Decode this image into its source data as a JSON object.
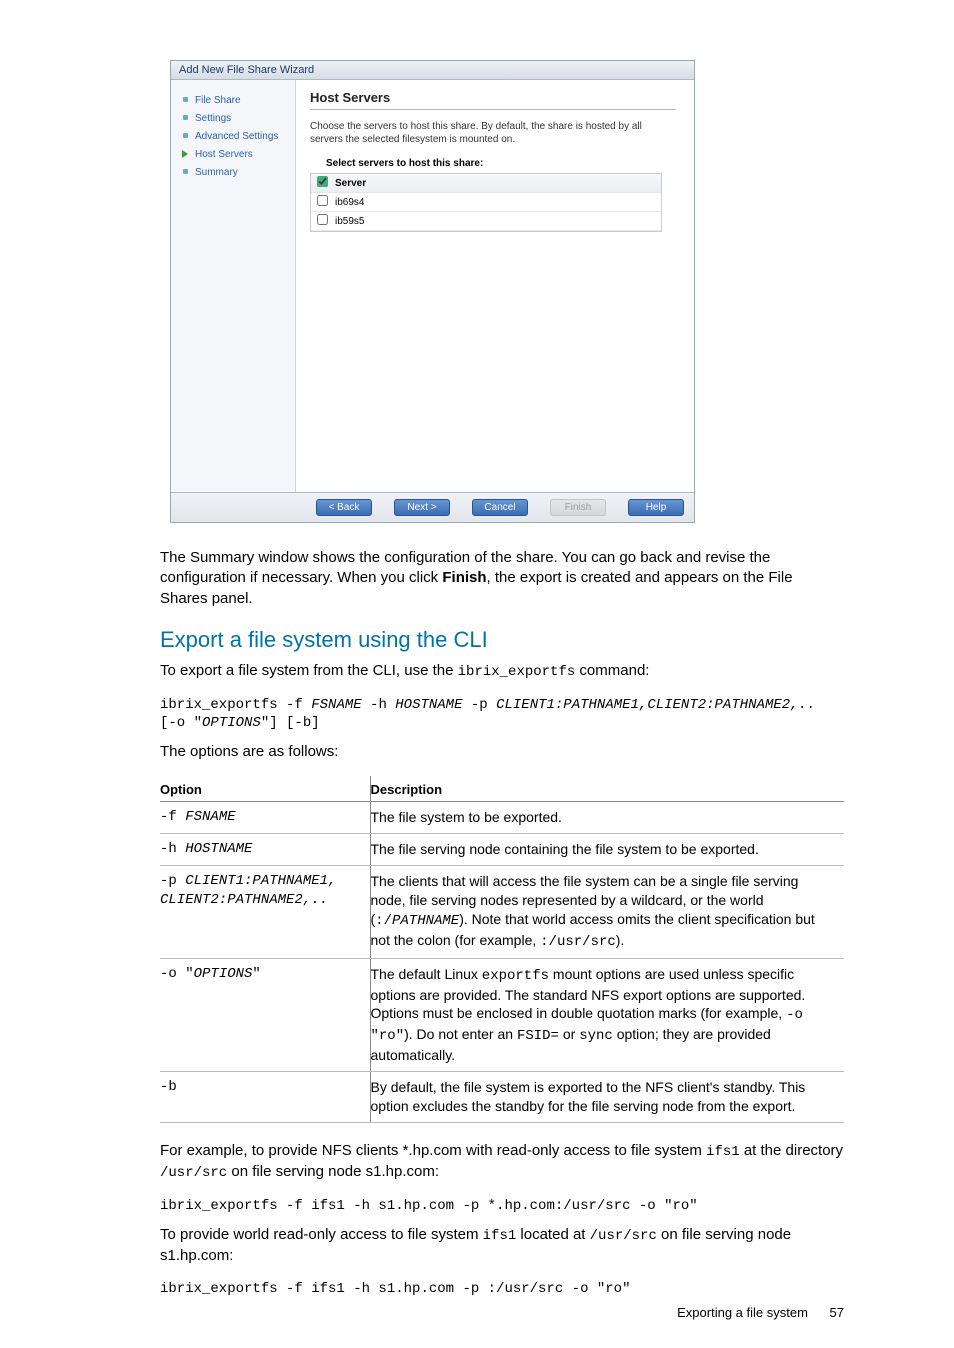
{
  "wizard": {
    "title": "Add New File Share Wizard",
    "steps": [
      "File Share",
      "Settings",
      "Advanced Settings",
      "Host Servers",
      "Summary"
    ],
    "current_step_index": 3,
    "heading": "Host Servers",
    "description": "Choose the servers to host this share. By default, the share is hosted by all servers the selected filesystem is mounted on.",
    "table_label": "Select servers to host this share:",
    "server_header": "Server",
    "servers": [
      {
        "name": "ib69s4",
        "checked": false
      },
      {
        "name": "ib59s5",
        "checked": false
      }
    ],
    "header_checked": true,
    "buttons": {
      "back": "< Back",
      "next": "Next >",
      "cancel": "Cancel",
      "finish": "Finish",
      "help": "Help"
    }
  },
  "para1_a": "The Summary window shows the configuration of the share. You can go back and revise the configuration if necessary. When you click ",
  "para1_bold": "Finish",
  "para1_b": ", the export is created and appears on the File Shares panel.",
  "h2": "Export a file system using the CLI",
  "para2_a": "To export a file system from the CLI, use the ",
  "para2_mono": "ibrix_exportfs",
  "para2_b": " command:",
  "code1_a": "ibrix_exportfs -f ",
  "code1_i1": "FSNAME",
  "code1_b": " -h ",
  "code1_i2": "HOSTNAME",
  "code1_c": " -p ",
  "code1_i3": "CLIENT1:PATHNAME1,CLIENT2:PATHNAME2,..",
  "code1_d": "\n[-o \"",
  "code1_i4": "OPTIONS",
  "code1_e": "\"] [-b]",
  "para3": "The options are as follows:",
  "opts_header": {
    "option": "Option",
    "description": "Description"
  },
  "opts": [
    {
      "opt_plain": "-f ",
      "opt_ital": "FSNAME",
      "desc_parts": [
        {
          "t": "text",
          "v": "The file system to be exported."
        }
      ]
    },
    {
      "opt_plain": "-h ",
      "opt_ital": "HOSTNAME",
      "desc_parts": [
        {
          "t": "text",
          "v": "The file serving node containing the file system to be exported."
        }
      ]
    },
    {
      "opt_plain": "-p ",
      "opt_ital": "CLIENT1:PATHNAME1,\nCLIENT2:PATHNAME2,..",
      "desc_parts": [
        {
          "t": "text",
          "v": "The clients that will access the file system can be a single file serving node, file serving nodes represented by a wildcard, or the world ("
        },
        {
          "t": "mono",
          "v": ":/"
        },
        {
          "t": "monoital",
          "v": "PATHNAME"
        },
        {
          "t": "text",
          "v": "). Note that world access omits the client specification but not the colon (for example, "
        },
        {
          "t": "mono",
          "v": ":/usr/src"
        },
        {
          "t": "text",
          "v": ")."
        }
      ]
    },
    {
      "opt_plain": "-o \"",
      "opt_ital": "OPTIONS",
      "opt_plain2": "\"",
      "desc_parts": [
        {
          "t": "text",
          "v": "The default Linux "
        },
        {
          "t": "mono",
          "v": "exportfs"
        },
        {
          "t": "text",
          "v": " mount options are used unless specific options are provided. The standard NFS export options are supported. Options must be enclosed in double quotation marks (for example, "
        },
        {
          "t": "mono",
          "v": " -o \"ro\""
        },
        {
          "t": "text",
          "v": "). Do not enter an "
        },
        {
          "t": "mono",
          "v": "FSID="
        },
        {
          "t": "text",
          "v": " or "
        },
        {
          "t": "mono",
          "v": "sync"
        },
        {
          "t": "text",
          "v": " option; they are provided automatically."
        }
      ]
    },
    {
      "opt_plain": "-b",
      "opt_ital": "",
      "desc_parts": [
        {
          "t": "text",
          "v": "By default, the file system is exported to the NFS client's standby. This option excludes the standby for the file serving node from the export."
        }
      ]
    }
  ],
  "para4_a": "For example, to provide NFS clients *.hp.com with read-only access to file system ",
  "para4_mono1": "ifs1",
  "para4_b": " at the directory ",
  "para4_mono2": "/usr/src",
  "para4_c": " on file serving node s1.hp.com:",
  "code2": "ibrix_exportfs -f ifs1 -h s1.hp.com -p *.hp.com:/usr/src -o \"ro\"",
  "para5_a": "To provide world read-only access to file system ",
  "para5_mono1": "ifs1",
  "para5_b": " located at ",
  "para5_mono2": "/usr/src",
  "para5_c": " on file serving node s1.hp.com:",
  "code3": "ibrix_exportfs -f ifs1 -h s1.hp.com -p :/usr/src -o \"ro\"",
  "footer": {
    "section": "Exporting a file system",
    "page": "57"
  }
}
